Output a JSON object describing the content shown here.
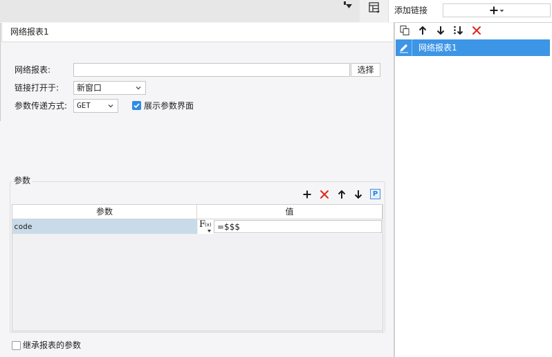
{
  "window": {
    "top_icons": [
      "dropdown-menu-icon",
      "hyperlink-panel-icon"
    ]
  },
  "left_panel": {
    "tab_label": "网络报表1",
    "form": {
      "report_label": "网络报表:",
      "report_value": "",
      "select_button": "选择",
      "open_in_label": "链接打开于:",
      "open_in_value": "新窗口",
      "method_label": "参数传递方式:",
      "method_value": "GET",
      "show_params_label": "展示参数界面",
      "show_params_checked": true
    },
    "params": {
      "section_label": "参数",
      "toolbar": {
        "icons": [
          "plus-icon",
          "delete-icon",
          "arrow-up-icon",
          "arrow-down-icon",
          "parameter-icon"
        ],
        "param_icon_text": "P"
      },
      "columns": [
        "参数",
        "值"
      ],
      "rows": [
        {
          "name": "code",
          "value": "=$$$",
          "selected": true
        }
      ],
      "formula_icon": {
        "main": "F",
        "sub": "(x)"
      }
    },
    "inherit_label": "继承报表的参数",
    "inherit_checked": false
  },
  "right_panel": {
    "add_link_label": "添加链接",
    "add_button_icons": [
      "plus-icon",
      "chevron-down-icon"
    ],
    "toolbar_icons": [
      "copy-icon",
      "arrow-up-icon",
      "arrow-down-icon",
      "sort-icon",
      "delete-icon"
    ],
    "links": [
      {
        "label": "网络报表1",
        "selected": true
      }
    ]
  },
  "colors": {
    "accent": "#3d95e6",
    "selected_row": "#c9dbe8",
    "delete": "#e0251b",
    "panel_bg": "#f5f5f7"
  }
}
